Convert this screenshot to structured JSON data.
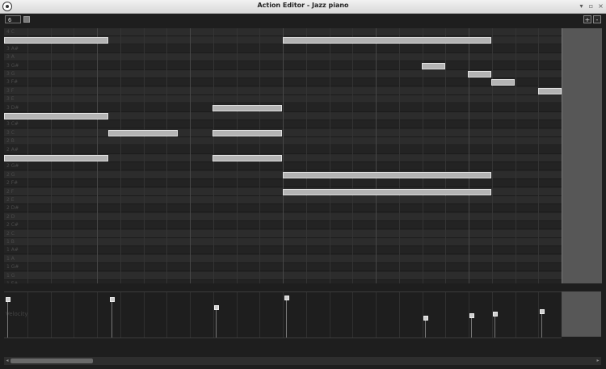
{
  "window": {
    "title": "Action Editor - Jazz piano",
    "controls": [
      "minimize-icon",
      "maximize-icon",
      "close-icon"
    ]
  },
  "toolbar": {
    "grid_value": "6",
    "zoom_in_label": "+",
    "zoom_out_label": "-"
  },
  "piano_roll": {
    "keys": [
      "4 C",
      "3 B",
      "3 A#",
      "3 A",
      "3 G#",
      "3 G",
      "3 F#",
      "3 F",
      "3 E",
      "3 D#",
      "3 D",
      "3 C#",
      "3 C",
      "2 B",
      "2 A#",
      "2 A",
      "2 G#",
      "2 G",
      "2 F#",
      "2 F",
      "2 E",
      "2 D#",
      "2 D",
      "2 C#",
      "2 C",
      "1 B",
      "1 A#",
      "1 A",
      "1 G#",
      "1 G",
      "1 F#"
    ],
    "notes": [
      {
        "key": "3 D",
        "start": 0,
        "length": 0.45
      },
      {
        "key": "3 C",
        "start": 0.45,
        "length": 0.3
      },
      {
        "key": "3 B",
        "start": 0,
        "length": 0.45
      },
      {
        "key": "2 A",
        "start": 0,
        "length": 0.45
      },
      {
        "key": "3 D#",
        "start": 0.9,
        "length": 0.3
      },
      {
        "key": "3 C",
        "start": 0.9,
        "length": 0.3
      },
      {
        "key": "2 A",
        "start": 0.9,
        "length": 0.3
      },
      {
        "key": "3 B",
        "start": 1.2,
        "length": 0.9
      },
      {
        "key": "2 G",
        "start": 1.2,
        "length": 0.9
      },
      {
        "key": "2 F",
        "start": 1.2,
        "length": 0.9
      },
      {
        "key": "3 G#",
        "start": 1.8,
        "length": 0.1
      },
      {
        "key": "3 G",
        "start": 2.0,
        "length": 0.1
      },
      {
        "key": "3 F#",
        "start": 2.1,
        "length": 0.1
      },
      {
        "key": "3 F",
        "start": 2.3,
        "length": 0.1
      }
    ]
  },
  "velocity": {
    "label": "Velocity",
    "values": [
      0.9,
      0.9,
      0.72,
      0.95,
      0.47,
      0.52,
      0.55,
      0.62
    ]
  }
}
